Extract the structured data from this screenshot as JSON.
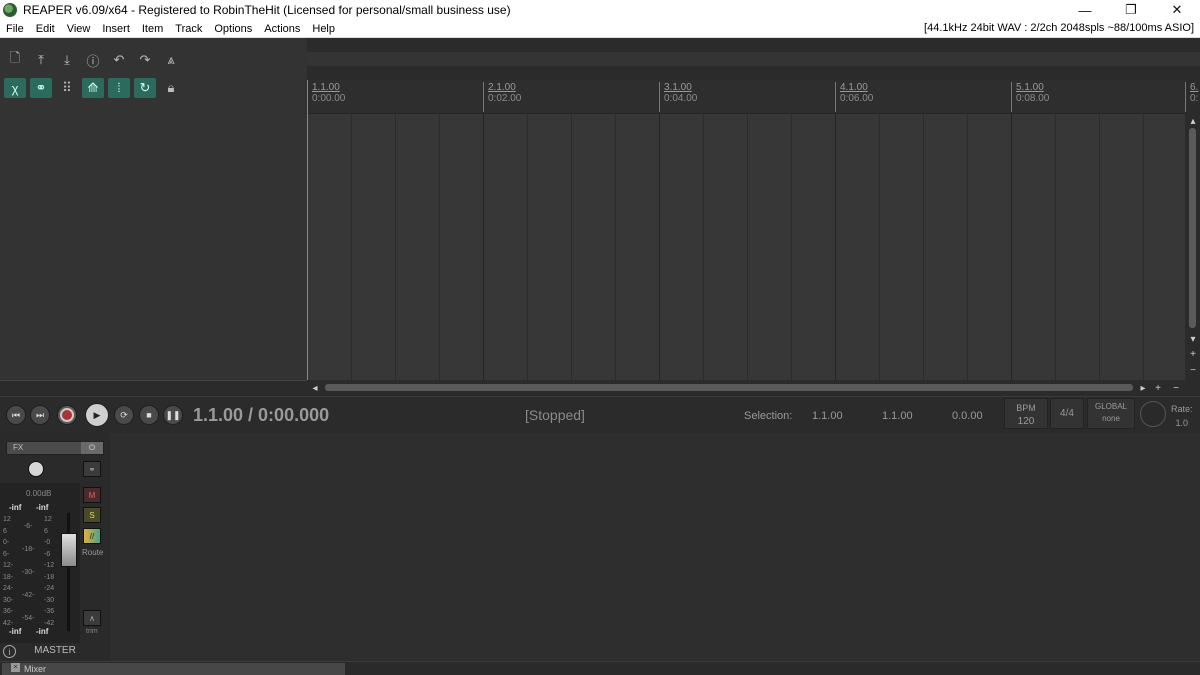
{
  "window": {
    "title": "REAPER v6.09/x64 - Registered to RobinTheHit (Licensed for personal/small business use)",
    "minimize": "—",
    "restore": "❐",
    "close": "✕"
  },
  "menu": {
    "items": [
      "File",
      "Edit",
      "View",
      "Insert",
      "Item",
      "Track",
      "Options",
      "Actions",
      "Help"
    ],
    "audio_status": "[44.1kHz 24bit WAV : 2/2ch 2048spls ~88/100ms ASIO]"
  },
  "toolbar": {
    "icons": [
      "new-project-icon",
      "open-project-icon",
      "save-project-icon",
      "project-settings-icon",
      "undo-icon",
      "redo-icon",
      "metronome-icon",
      "ripple-edit-icon",
      "link-icon",
      "grid-icon",
      "envelope-lock-icon",
      "snap-icon",
      "loop-icon",
      "lock-icon"
    ]
  },
  "ruler": {
    "marks": [
      {
        "bar": "1.1.00",
        "time": "0:00.00"
      },
      {
        "bar": "2.1.00",
        "time": "0:02.00"
      },
      {
        "bar": "3.1.00",
        "time": "0:04.00"
      },
      {
        "bar": "4.1.00",
        "time": "0:06.00"
      },
      {
        "bar": "5.1.00",
        "time": "0:08.00"
      },
      {
        "bar": "6.",
        "time": "0:"
      }
    ]
  },
  "transport": {
    "position": "1.1.00 / 0:00.000",
    "state": "[Stopped]",
    "selection_label": "Selection:",
    "selection_start": "1.1.00",
    "selection_end": "1.1.00",
    "selection_length": "0.0.00",
    "bpm_label": "BPM",
    "bpm_value": "120",
    "time_signature": "4/4",
    "global_label": "GLOBAL",
    "global_value": "none",
    "rate_label": "Rate:",
    "rate_value": "1.0"
  },
  "mixer": {
    "fx_label": "FX",
    "volume_db": "0.00dB",
    "peak_left": "-inf",
    "peak_right": "-inf",
    "mute": "M",
    "solo": "S",
    "route": "Route",
    "trim": "trim",
    "master": "MASTER",
    "left_scale": "12\n6\n0-\n6-\n12-\n18-\n24-\n30-\n36-\n42-",
    "mid_scale": "-6-\n\n-18-\n\n-30-\n\n-42-\n\n-54-",
    "right_scale": "12\n6\n-0\n-6\n-12\n-18\n-24\n-30\n-36\n-42",
    "bottom_left": "-inf",
    "bottom_right": "-inf"
  },
  "dock": {
    "mixer_tab": "Mixer"
  },
  "colors": {
    "accent": "#4aa38f",
    "record": "#aa3333"
  }
}
